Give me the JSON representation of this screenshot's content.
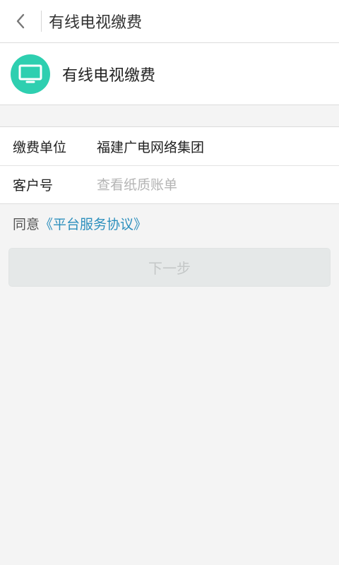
{
  "topbar": {
    "title": "有线电视缴费",
    "back_icon": "chevron-left-icon"
  },
  "service": {
    "icon": "tv-icon",
    "title": "有线电视缴费",
    "accent_color": "#2ecfb0"
  },
  "form": {
    "unit_label": "缴费单位",
    "unit_value": "福建广电网络集团",
    "account_label": "客户号",
    "account_placeholder": "查看纸质账单",
    "account_value": ""
  },
  "agreement": {
    "prefix": "同意",
    "link": "《平台服务协议》",
    "link_color": "#2c8fbd"
  },
  "next_button": {
    "label": "下一步",
    "enabled": false
  }
}
